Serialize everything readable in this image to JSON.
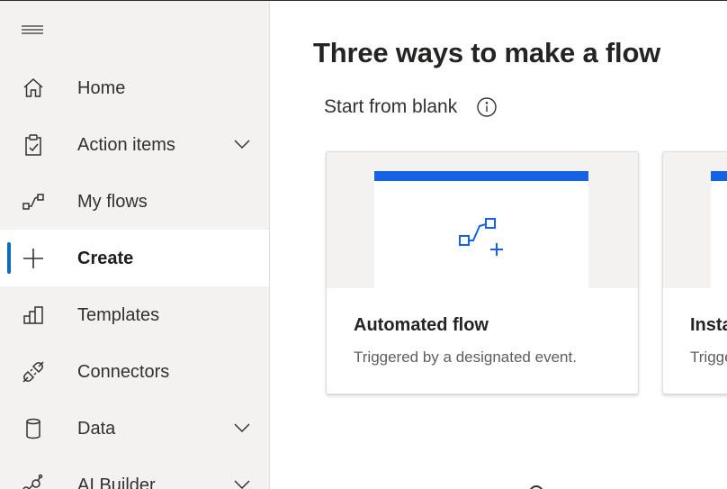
{
  "sidebar": {
    "menu_icon": "hamburger-icon",
    "items": [
      {
        "label": "Home",
        "icon": "home-icon",
        "expandable": false,
        "selected": false
      },
      {
        "label": "Action items",
        "icon": "clipboard-check-icon",
        "expandable": true,
        "selected": false
      },
      {
        "label": "My flows",
        "icon": "flow-icon",
        "expandable": false,
        "selected": false
      },
      {
        "label": "Create",
        "icon": "plus-icon",
        "expandable": false,
        "selected": true
      },
      {
        "label": "Templates",
        "icon": "templates-icon",
        "expandable": false,
        "selected": false
      },
      {
        "label": "Connectors",
        "icon": "plug-icon",
        "expandable": false,
        "selected": false
      },
      {
        "label": "Data",
        "icon": "database-icon",
        "expandable": true,
        "selected": false
      },
      {
        "label": "AI Builder",
        "icon": "ai-builder-icon",
        "expandable": true,
        "selected": false
      }
    ]
  },
  "main": {
    "title": "Three ways to make a flow",
    "section_title": "Start from blank",
    "section_info_icon": "info-icon",
    "cards": [
      {
        "title": "Automated flow",
        "description": "Triggered by a designated event.",
        "icon": "automated-flow-icon"
      },
      {
        "title": "Instant cloud flow",
        "description": "Trigger manually as needed.",
        "icon": "instant-flow-icon"
      }
    ]
  },
  "colors": {
    "accent": "#0f6cbd",
    "card_bar": "#1662e7",
    "sidebar_bg": "#f3f2f1",
    "selected_bg": "#ffffff"
  }
}
